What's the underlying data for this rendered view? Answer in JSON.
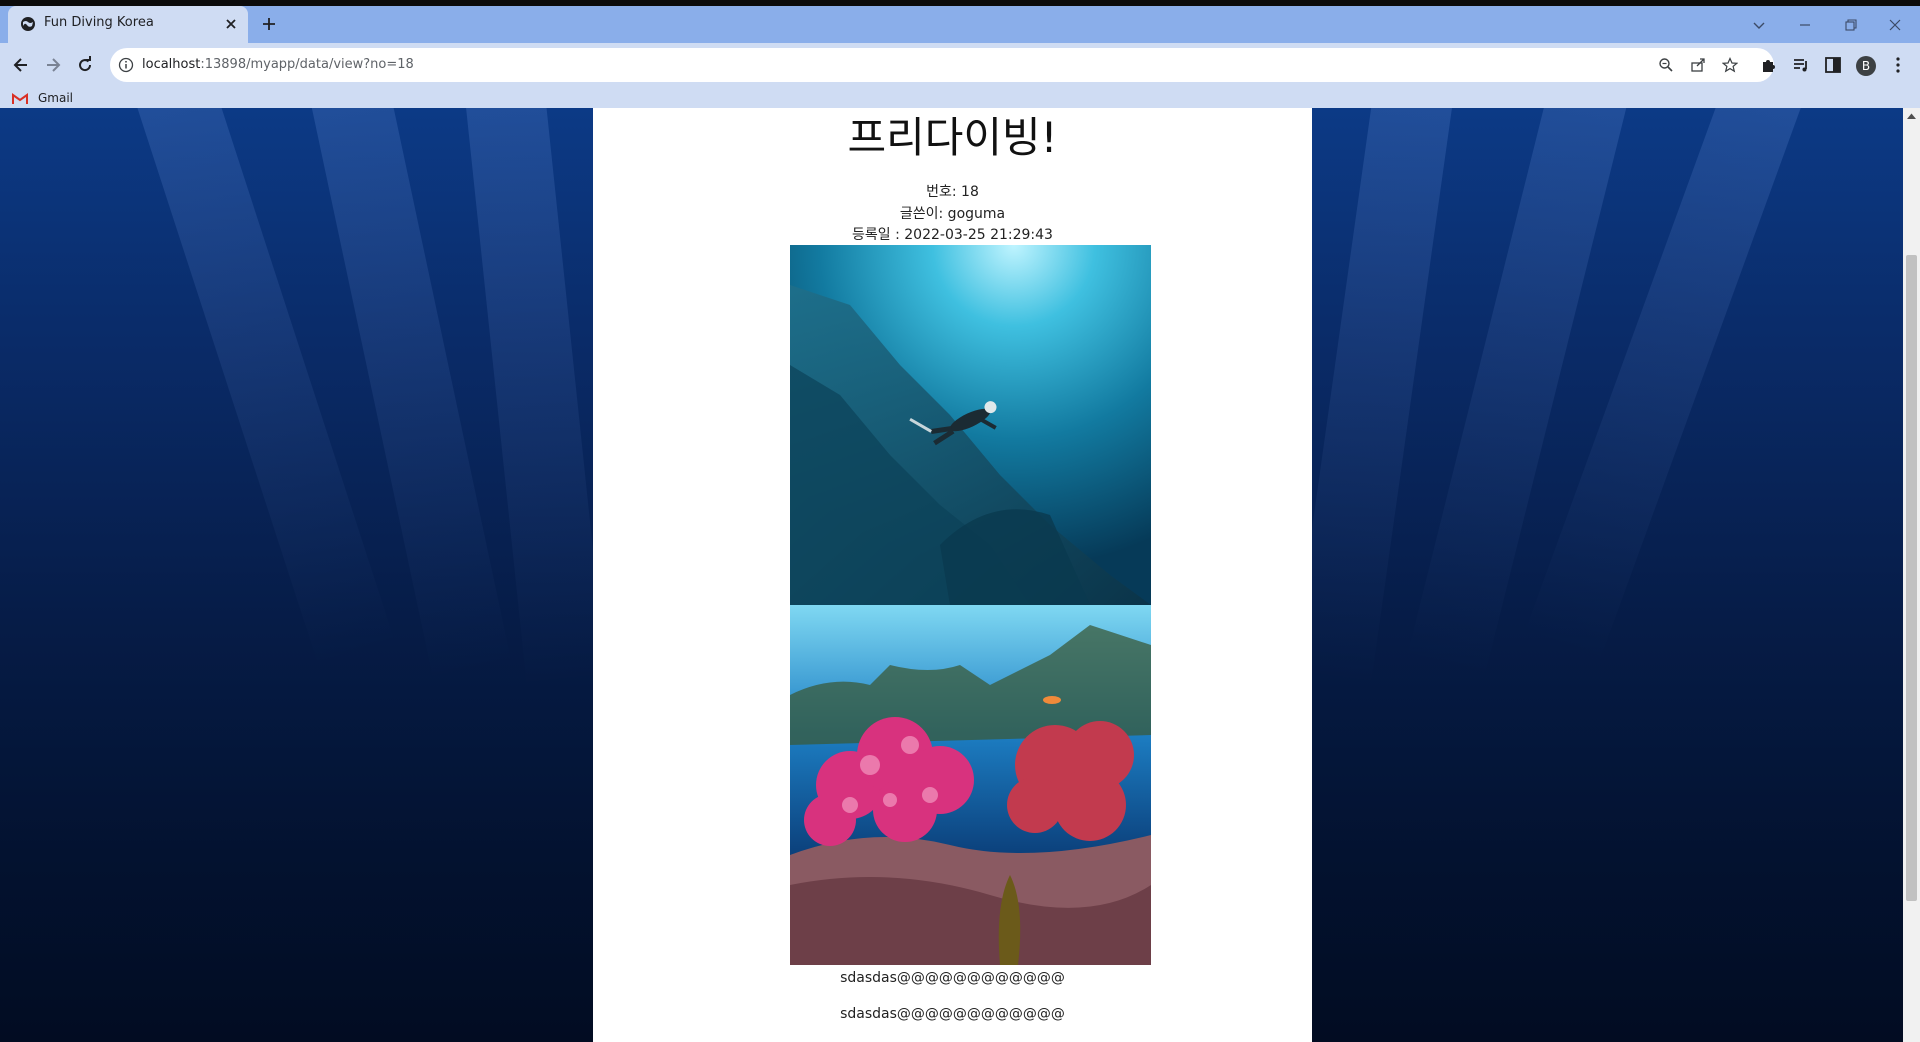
{
  "browser": {
    "tab_title": "Fun Diving Korea",
    "url_host": "localhost",
    "url_rest": ":13898/myapp/data/view?no=18",
    "bookmark_label": "Gmail",
    "profile_initial": "B"
  },
  "post": {
    "title": "프리다이빙!",
    "number_line": "번호: 18",
    "author_line": "글쓴이: goguma",
    "date_line": "등록일 : 2022-03-25 21:29:43",
    "body_lines": [
      "sdasdas@@@@@@@@@@@@",
      "sdasdas@@@@@@@@@@@@"
    ]
  },
  "colors": {
    "chrome_tabstrip": "#8aaeea",
    "chrome_toolbar": "#cfdcf3",
    "ocean_top": "#0c3a86",
    "ocean_bottom": "#020c22"
  }
}
